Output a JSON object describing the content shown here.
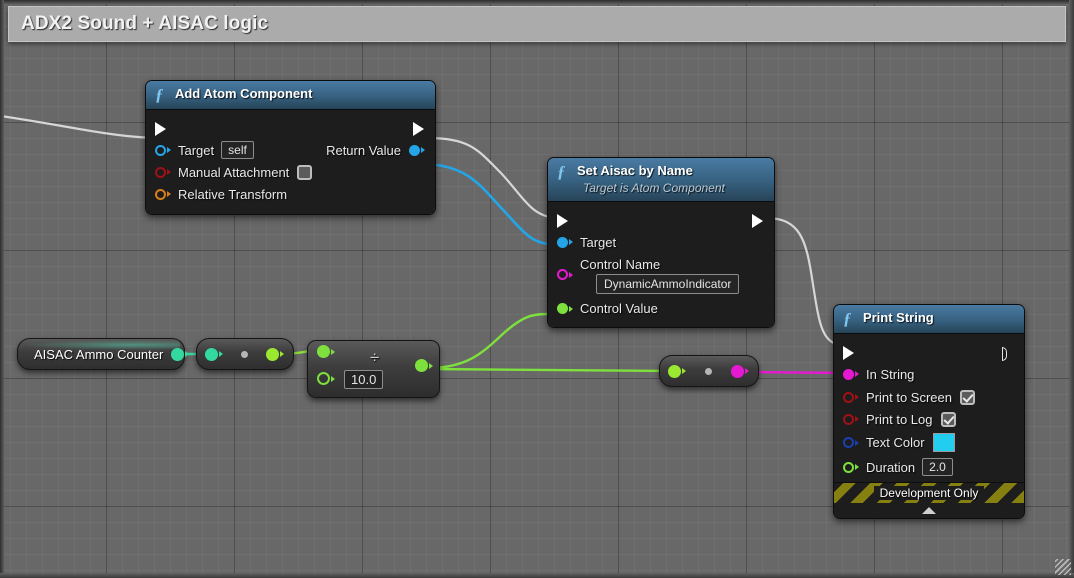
{
  "comment": {
    "title": "ADX2 Sound + AISAC logic"
  },
  "nodes": {
    "add_atom_component": {
      "title": "Add Atom Component",
      "fx_icon": "function-icon",
      "exec_in": "exec-in-pin",
      "exec_out": "exec-out-pin",
      "pins": [
        {
          "label": "Target",
          "value": "self",
          "color": "#23a5e8",
          "type": "object"
        },
        {
          "label": "Manual Attachment",
          "checked": false,
          "color": "#9e1216",
          "type": "bool"
        },
        {
          "label": "Relative Transform",
          "color": "#d97e16",
          "type": "struct"
        }
      ],
      "out_pins": [
        {
          "label": "Return Value",
          "color": "#23a5e8"
        }
      ]
    },
    "set_aisac_by_name": {
      "title": "Set Aisac by Name",
      "subtitle": "Target is Atom Component",
      "fx_icon": "function-icon",
      "pins": [
        {
          "label": "Target",
          "color": "#23a5e8"
        },
        {
          "label": "Control Name",
          "value": "DynamicAmmoIndicator",
          "color": "#e619d2"
        },
        {
          "label": "Control Value",
          "color": "#7ee03c"
        }
      ]
    },
    "print_string": {
      "title": "Print String",
      "fx_icon": "function-icon",
      "pins": [
        {
          "label": "In String",
          "color": "#e619d2"
        },
        {
          "label": "Print to Screen",
          "checked": true,
          "color": "#9e1216"
        },
        {
          "label": "Print to Log",
          "checked": true,
          "color": "#9e1216"
        },
        {
          "label": "Text Color",
          "swatch": "#22cdf0",
          "color": "#1b3fb0"
        },
        {
          "label": "Duration",
          "value": "2.0",
          "color": "#7ee03c"
        }
      ],
      "footer": "Development Only"
    },
    "aisac_ammo_counter": {
      "label": "AISAC Ammo Counter",
      "pin_color": "#34d9a0"
    },
    "convert_int_to_float": {
      "in_color": "#34d9a0",
      "out_color": "#9ae830",
      "dot_color": "#b5b5b5"
    },
    "divide_node": {
      "symbol": "÷",
      "value": "10.0",
      "in_color": "#7ee03c",
      "out_color": "#7ee03c"
    },
    "float_to_string": {
      "in_color": "#9ae830",
      "out_color": "#e619d2",
      "dot_color": "#b5b5b5"
    }
  },
  "wires": [
    {
      "name": "exec-in-to-add-atom",
      "color": "#d6d6d6"
    },
    {
      "name": "add-atom-exec-to-set-aisac-exec",
      "color": "#d6d6d6"
    },
    {
      "name": "return-value-to-target",
      "color": "#23a5e8"
    },
    {
      "name": "set-aisac-exec-to-print-string-exec",
      "color": "#d6d6d6"
    },
    {
      "name": "counter-to-convert",
      "color": "#3fd9a2"
    },
    {
      "name": "convert-to-divide",
      "color": "#8ee03c"
    },
    {
      "name": "divide-to-control-value",
      "color": "#7ee03c"
    },
    {
      "name": "divide-to-float-to-string",
      "color": "#7ee03c"
    },
    {
      "name": "float-to-string-to-in-string",
      "color": "#e619d2"
    }
  ],
  "canvas": {
    "resize_grip": "resize-grip"
  }
}
